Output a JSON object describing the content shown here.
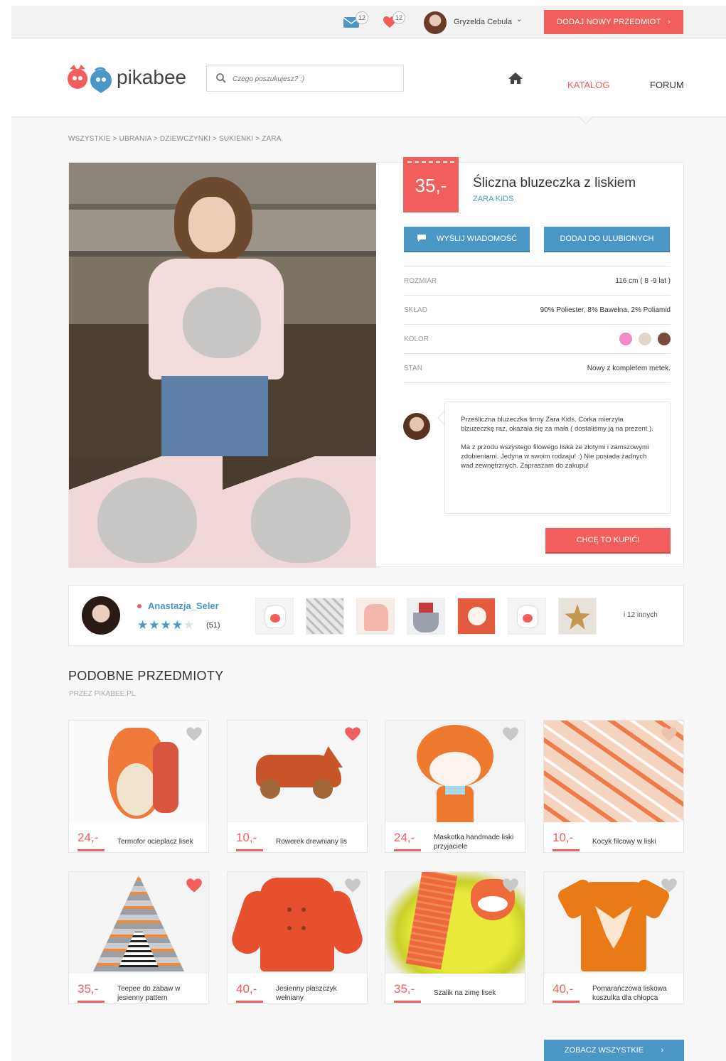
{
  "topbar": {
    "messages_count": "12",
    "favorites_count": "12",
    "user_name": "Gryzelda Cebula",
    "add_button": "DODAJ NOWY PRZEDMIOT"
  },
  "header": {
    "logo_text": "pikabee",
    "search_placeholder": "Czego poszukujesz? :)",
    "nav": {
      "katalog": "KATALOG",
      "forum": "FORUM"
    }
  },
  "breadcrumb": "WSZYSTKIE > UBRANIA > DZIEWCZYNKI > SUKIENKI > ZARA",
  "product": {
    "price": "35,-",
    "title": "Śliczna bluzeczka z liskiem",
    "brand": "ZARA KIDS",
    "btn_message": "WYŚLIJ WIADOMOŚĆ",
    "btn_favorite": "DODAJ DO ULUBIONYCH",
    "attributes": [
      {
        "key": "ROZMIAR",
        "value": "116 cm ( 8 -9 lat )"
      },
      {
        "key": "SKŁAD",
        "value": "90% Poliester, 8% Bawełna, 2% Poliamid"
      },
      {
        "key": "KOLOR",
        "value": ""
      },
      {
        "key": "STAN",
        "value": "Nowy z kompletem metek."
      }
    ],
    "colors": [
      "#f08ac6",
      "#e2d6c9",
      "#7a4a3d"
    ],
    "description": [
      "Prześliczna bluzeczka firmy Zara Kids. Córka mierzyła blzuzeczkę raz, okazała się za mała ( dostaliśmy ją na prezent ).",
      "Ma z przodu wszystego filowego liska ze złotymi i zamszowymi zdobieniami. Jedyna w swoim rodzaju! :) Nie posiada żadnych wad zewnętrznych. Zapraszam do zakupu!"
    ],
    "btn_buy": "CHCĘ TO KUPIĆ!"
  },
  "seller": {
    "name": "Anastazja_Seler",
    "rating_count": "(51)",
    "rating": 4,
    "rating_max": 5,
    "more": "i 12 innych"
  },
  "similar": {
    "title": "PODOBNE PRZEDMIOTY",
    "subtitle": "PRZEZ PIKABEE.PL",
    "items": [
      {
        "price": "24,-",
        "name": "Termofor ocieplacz lisek",
        "favorited": false
      },
      {
        "price": "10,-",
        "name": "Rowerek drewniany lis",
        "favorited": true
      },
      {
        "price": "24,-",
        "name": "Maskotka handmade liski przyjaciele",
        "favorited": false
      },
      {
        "price": "10,-",
        "name": "Kocyk filcowy w liski",
        "favorited": false
      },
      {
        "price": "35,-",
        "name": "Teepee do zabaw w jesienny pattern",
        "favorited": true
      },
      {
        "price": "40,-",
        "name": "Jesienny płaszczyk wełniany",
        "favorited": false
      },
      {
        "price": "35,-",
        "name": "Szalik na zimę lisek",
        "favorited": false
      },
      {
        "price": "40,-",
        "name": "Pomarańczowa liskowa koszulka dla chłopca",
        "favorited": false
      }
    ],
    "see_all": "ZOBACZ WSZYSTKIE"
  },
  "colors": {
    "accent_red": "#f25e5b",
    "accent_blue": "#4a97c5"
  }
}
